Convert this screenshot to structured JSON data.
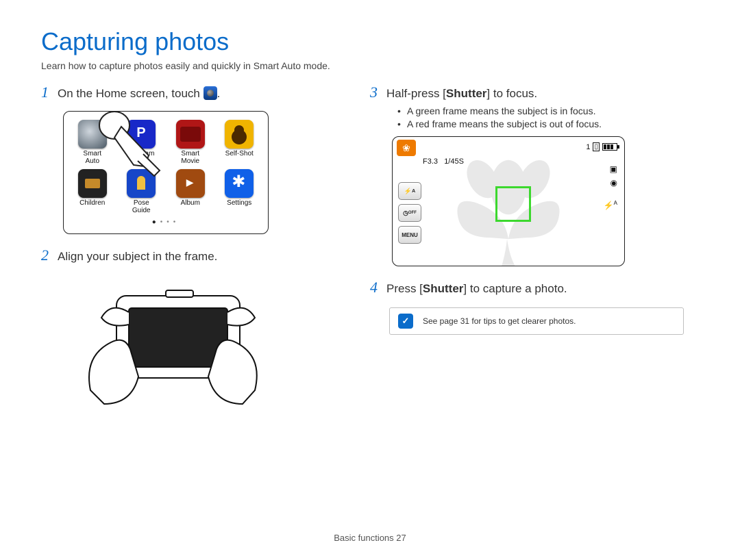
{
  "title": "Capturing photos",
  "intro": "Learn how to capture photos easily and quickly in Smart Auto mode.",
  "steps": {
    "s1": {
      "num": "1",
      "pre": "On the Home screen, touch ",
      "post": "."
    },
    "s2": {
      "num": "2",
      "text": "Align your subject in the frame."
    },
    "s3": {
      "num": "3",
      "pre": "Half-press [",
      "bold": "Shutter",
      "post": "] to focus."
    },
    "s4": {
      "num": "4",
      "pre": "Press [",
      "bold": "Shutter",
      "post": "] to capture a photo."
    }
  },
  "bullets": [
    "A green frame means the subject is in focus.",
    "A red frame means the subject is out of focus."
  ],
  "home_apps": [
    {
      "label": "Smart\nAuto",
      "cls": "ic-auto"
    },
    {
      "label": "Program",
      "cls": "ic-prog"
    },
    {
      "label": "Smart\nMovie",
      "cls": "ic-movie"
    },
    {
      "label": "Self-Shot",
      "cls": "ic-self"
    },
    {
      "label": "Children",
      "cls": "ic-child"
    },
    {
      "label": "Pose\nGuide",
      "cls": "ic-pose"
    },
    {
      "label": "Album",
      "cls": "ic-album"
    },
    {
      "label": "Settings",
      "cls": "ic-sett"
    }
  ],
  "shot": {
    "counter": "1",
    "aperture": "F3.3",
    "shutter": "1/45S",
    "menu_label": "MENU",
    "flash_label": "A",
    "timer_label": "OFF"
  },
  "note": "See page 31 for tips to get clearer photos.",
  "footer": {
    "section": "Basic functions ",
    "page": "27"
  }
}
